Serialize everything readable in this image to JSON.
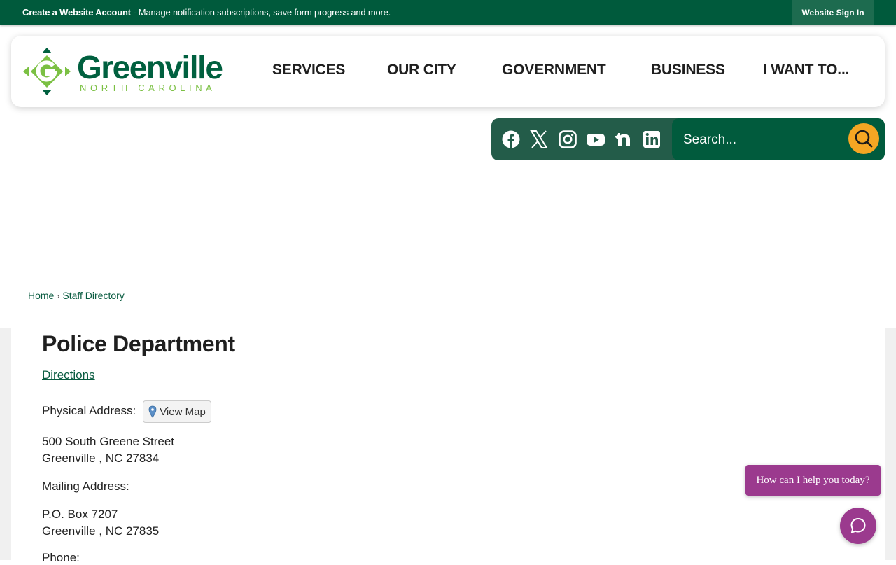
{
  "topbar": {
    "create_account": "Create a Website Account",
    "message": " - Manage notification subscriptions, save form progress and more.",
    "signin": "Website Sign In"
  },
  "logo": {
    "name": "Greenville",
    "sub": "NORTH CAROLINA",
    "icon": "greenville-g-logo-icon",
    "colors": {
      "dark_green": "#00603f",
      "light_green": "#7bc043"
    }
  },
  "nav": {
    "items": [
      {
        "label": "SERVICES"
      },
      {
        "label": "OUR CITY"
      },
      {
        "label": "GOVERNMENT"
      },
      {
        "label": "BUSINESS"
      },
      {
        "label": "I WANT TO..."
      }
    ]
  },
  "social": {
    "icons": [
      "facebook-icon",
      "x-twitter-icon",
      "instagram-icon",
      "youtube-icon",
      "nextdoor-icon",
      "linkedin-icon"
    ]
  },
  "search": {
    "placeholder": "Search...",
    "button_icon": "search-icon",
    "button_color": "#f5a623"
  },
  "breadcrumb": {
    "home": "Home",
    "separator": "›",
    "current": "Staff Directory"
  },
  "department": {
    "title": "Police Department",
    "directions": "Directions",
    "physical_label": "Physical Address:",
    "view_map": "View Map",
    "physical_street": "500 South Greene Street",
    "physical_city": "Greenville , NC 27834",
    "mailing_label": "Mailing Address:",
    "mailing_street": "P.O. Box 7207",
    "mailing_city": "Greenville , NC 27835",
    "phone_label": "Phone:"
  },
  "chat": {
    "prompt": "How can I help you today?",
    "icon": "chat-bubble-icon",
    "color": "#9b3a8e"
  },
  "theme": {
    "primary_green": "#005a3c",
    "link_green": "#0a5c41"
  }
}
